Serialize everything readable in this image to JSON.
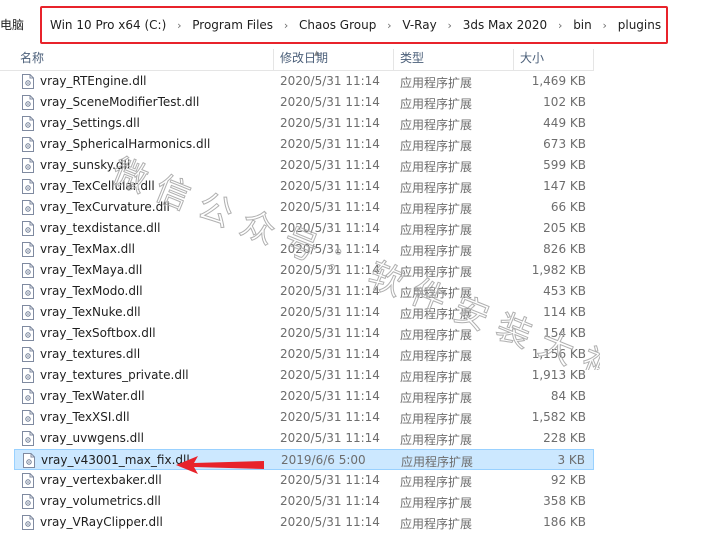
{
  "breadcrumb": {
    "root": "电脑",
    "items": [
      "Win 10 Pro x64 (C:)",
      "Program Files",
      "Chaos Group",
      "V-Ray",
      "3ds Max 2020",
      "bin",
      "plugins"
    ],
    "separator": "›"
  },
  "columns": {
    "name": "名称",
    "date": "修改日期",
    "type": "类型",
    "size": "大小",
    "sorted_by": "name"
  },
  "files": [
    {
      "name": "vray_RTEngine.dll",
      "date": "2020/5/31 11:14",
      "type": "应用程序扩展",
      "size": "1,469 KB",
      "selected": false
    },
    {
      "name": "vray_SceneModifierTest.dll",
      "date": "2020/5/31 11:14",
      "type": "应用程序扩展",
      "size": "102 KB",
      "selected": false
    },
    {
      "name": "vray_Settings.dll",
      "date": "2020/5/31 11:14",
      "type": "应用程序扩展",
      "size": "449 KB",
      "selected": false
    },
    {
      "name": "vray_SphericalHarmonics.dll",
      "date": "2020/5/31 11:14",
      "type": "应用程序扩展",
      "size": "673 KB",
      "selected": false
    },
    {
      "name": "vray_sunsky.dll",
      "date": "2020/5/31 11:14",
      "type": "应用程序扩展",
      "size": "599 KB",
      "selected": false
    },
    {
      "name": "vray_TexCellular.dll",
      "date": "2020/5/31 11:14",
      "type": "应用程序扩展",
      "size": "147 KB",
      "selected": false
    },
    {
      "name": "vray_TexCurvature.dll",
      "date": "2020/5/31 11:14",
      "type": "应用程序扩展",
      "size": "66 KB",
      "selected": false
    },
    {
      "name": "vray_texdistance.dll",
      "date": "2020/5/31 11:14",
      "type": "应用程序扩展",
      "size": "205 KB",
      "selected": false
    },
    {
      "name": "vray_TexMax.dll",
      "date": "2020/5/31 11:14",
      "type": "应用程序扩展",
      "size": "826 KB",
      "selected": false
    },
    {
      "name": "vray_TexMaya.dll",
      "date": "2020/5/31 11:14",
      "type": "应用程序扩展",
      "size": "1,982 KB",
      "selected": false
    },
    {
      "name": "vray_TexModo.dll",
      "date": "2020/5/31 11:14",
      "type": "应用程序扩展",
      "size": "453 KB",
      "selected": false
    },
    {
      "name": "vray_TexNuke.dll",
      "date": "2020/5/31 11:14",
      "type": "应用程序扩展",
      "size": "114 KB",
      "selected": false
    },
    {
      "name": "vray_TexSoftbox.dll",
      "date": "2020/5/31 11:14",
      "type": "应用程序扩展",
      "size": "154 KB",
      "selected": false
    },
    {
      "name": "vray_textures.dll",
      "date": "2020/5/31 11:14",
      "type": "应用程序扩展",
      "size": "1,156 KB",
      "selected": false
    },
    {
      "name": "vray_textures_private.dll",
      "date": "2020/5/31 11:14",
      "type": "应用程序扩展",
      "size": "1,913 KB",
      "selected": false
    },
    {
      "name": "vray_TexWater.dll",
      "date": "2020/5/31 11:14",
      "type": "应用程序扩展",
      "size": "84 KB",
      "selected": false
    },
    {
      "name": "vray_TexXSI.dll",
      "date": "2020/5/31 11:14",
      "type": "应用程序扩展",
      "size": "1,582 KB",
      "selected": false
    },
    {
      "name": "vray_uvwgens.dll",
      "date": "2020/5/31 11:14",
      "type": "应用程序扩展",
      "size": "228 KB",
      "selected": false
    },
    {
      "name": "vray_v43001_max_fix.dll",
      "date": "2019/6/6 5:00",
      "type": "应用程序扩展",
      "size": "3 KB",
      "selected": true
    },
    {
      "name": "vray_vertexbaker.dll",
      "date": "2020/5/31 11:14",
      "type": "应用程序扩展",
      "size": "92 KB",
      "selected": false
    },
    {
      "name": "vray_volumetrics.dll",
      "date": "2020/5/31 11:14",
      "type": "应用程序扩展",
      "size": "358 KB",
      "selected": false
    },
    {
      "name": "vray_VRayClipper.dll",
      "date": "2020/5/31 11:14",
      "type": "应用程序扩展",
      "size": "186 KB",
      "selected": false
    }
  ],
  "watermark": "微信公众号：软件安装大神",
  "colors": {
    "annotation_red": "#e8232b",
    "selection_bg": "#cce8ff",
    "selection_border": "#99d1ff",
    "header_text": "#4c607a"
  },
  "icons": {
    "file": "dll-file-icon",
    "separator": "chevron-right-icon",
    "annotation": "red-arrow-annotation"
  }
}
